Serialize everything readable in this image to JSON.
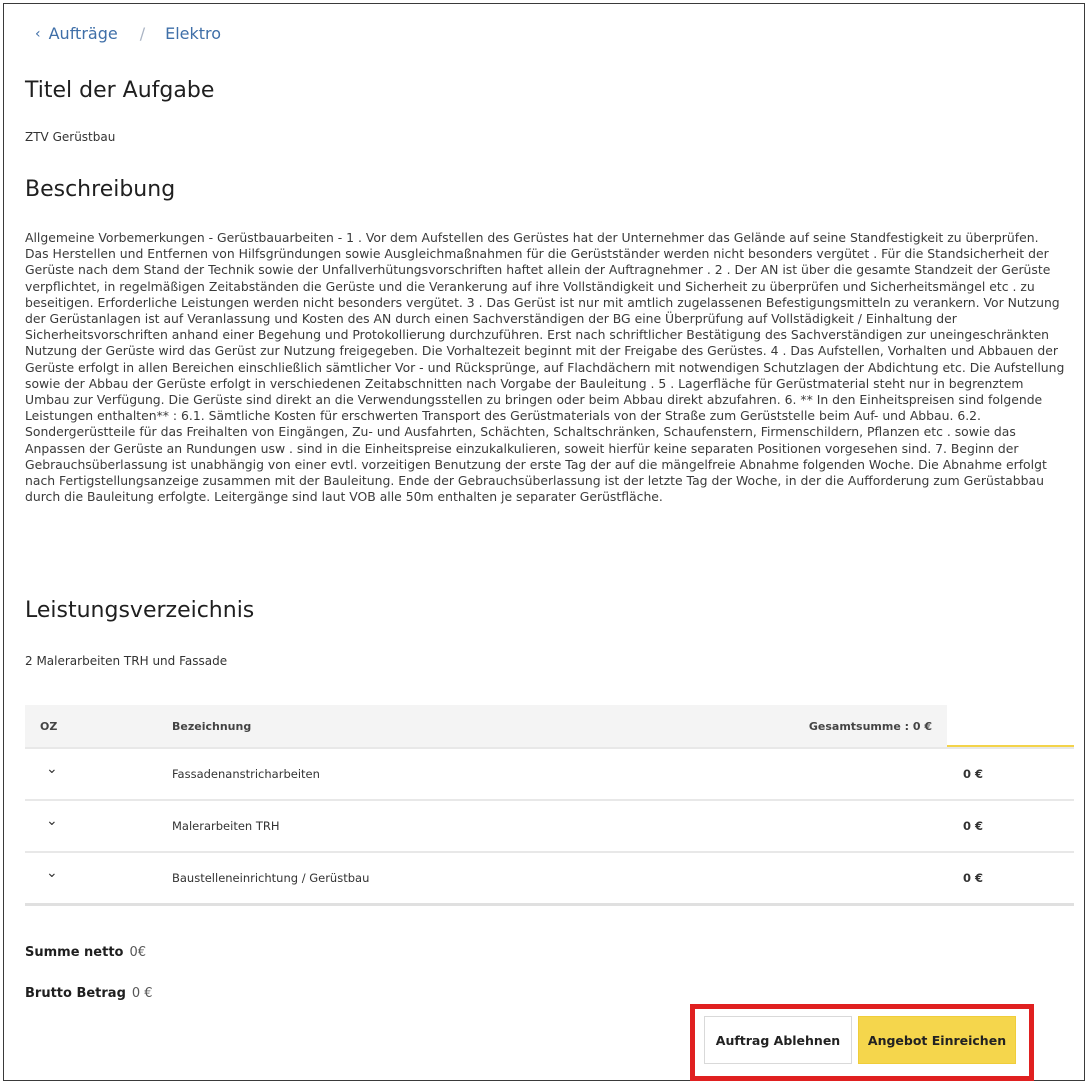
{
  "breadcrumb": {
    "back_label": "Aufträge",
    "current": "Elektro"
  },
  "title_section": {
    "heading": "Titel der Aufgabe",
    "value": "ZTV Gerüstbau"
  },
  "description_section": {
    "heading": "Beschreibung",
    "text": "Allgemeine Vorbemerkungen - Gerüstbauarbeiten - 1 . Vor dem Aufstellen des Gerüstes hat der Unternehmer das Gelände auf seine Standfestigkeit zu überprüfen. Das Herstellen und Entfernen von Hilfsgründungen sowie Ausgleichmaßnahmen für die Gerüstständer werden nicht besonders vergütet . Für die Standsicherheit der Gerüste nach dem Stand der Technik sowie der Unfallverhütungsvorschriften haftet allein der Auftragnehmer . 2 . Der AN ist über die gesamte Standzeit der Gerüste verpflichtet, in regelmäßigen Zeitabständen die Gerüste und die Verankerung auf ihre Vollständigkeit und Sicherheit zu überprüfen und Sicherheitsmängel etc . zu beseitigen. Erforderliche Leistungen werden nicht besonders vergütet. 3 . Das Gerüst ist nur mit amtlich zugelassenen Befestigungsmitteln zu verankern. Vor Nutzung der Gerüstanlagen ist auf Veranlassung und Kosten des AN durch einen Sachverständigen der BG eine Überprüfung auf Vollstädigkeit / Einhaltung der Sicherheitsvorschriften anhand einer Begehung und Protokollierung durchzuführen. Erst nach schriftlicher Bestätigung des Sachverständigen zur uneingeschränkten Nutzung der Gerüste wird das Gerüst zur Nutzung freigegeben. Die Vorhaltezeit beginnt mit der Freigabe des Gerüstes. 4 . Das Aufstellen, Vorhalten und Abbauen der Gerüste erfolgt in allen Bereichen einschließlich sämtlicher Vor - und Rücksprünge, auf Flachdächern mit notwendigen Schutzlagen der Abdichtung etc. Die Aufstellung sowie der Abbau der Gerüste erfolgt in verschiedenen Zeitabschnitten nach Vorgabe der Bauleitung . 5 . Lagerfläche für Gerüstmaterial steht nur in begrenztem Umbau zur Verfügung. Die Gerüste sind direkt an die Verwendungsstellen zu bringen oder beim Abbau direkt abzufahren. 6. ** In den Einheitspreisen sind folgende Leistungen enthalten** : 6.1. Sämtliche Kosten für erschwerten Transport des Gerüstmaterials von der Straße zum Gerüststelle beim Auf- und Abbau. 6.2. Sondergerüstteile für das Freihalten von Eingängen, Zu- und Ausfahrten, Schächten, Schaltschränken, Schaufenstern, Firmenschildern, Pflanzen etc . sowie das Anpassen der Gerüste an Rundungen usw . sind in die Einheitspreise einzukalkulieren, soweit hierfür keine separaten Positionen vorgesehen sind. 7. Beginn der Gebrauchsüberlassung ist unabhängig von einer evtl. vorzeitigen Benutzung der erste Tag der auf die mängelfreie Abnahme folgenden Woche. Die Abnahme erfolgt nach Fertigstellungsanzeige zusammen mit der Bauleitung. Ende der Gebrauchsüberlassung ist der letzte Tag der Woche, in der die Aufforderung zum Gerüstabbau durch die Bauleitung erfolgte. Leitergänge sind laut VOB alle 50m enthalten je separater Gerüstfläche."
  },
  "services_section": {
    "heading": "Leistungsverzeichnis",
    "subtitle": "2 Malerarbeiten TRH und Fassade",
    "table": {
      "col_oz": "OZ",
      "col_name": "Bezeichnung",
      "col_total": "Gesamtsumme : 0 €",
      "rows": [
        {
          "name": "Fassadenanstricharbeiten",
          "amount": "0 €",
          "expand_icon": "chevron-down-icon"
        },
        {
          "name": "Malerarbeiten TRH",
          "amount": "0 €",
          "expand_icon": "chevron-down-icon"
        },
        {
          "name": "Baustelleneinrichtung / Gerüstbau",
          "amount": "0 €",
          "expand_icon": "chevron-down-icon"
        }
      ]
    }
  },
  "totals": {
    "net_label": "Summe netto",
    "net_value": "0€",
    "gross_label": "Brutto Betrag",
    "gross_value": "0 €"
  },
  "actions": {
    "reject_label": "Auftrag Ablehnen",
    "submit_label": "Angebot Einreichen"
  },
  "colors": {
    "link": "#3f6fa8",
    "accent_yellow": "#f5d64c",
    "highlight_red": "#e02020"
  }
}
